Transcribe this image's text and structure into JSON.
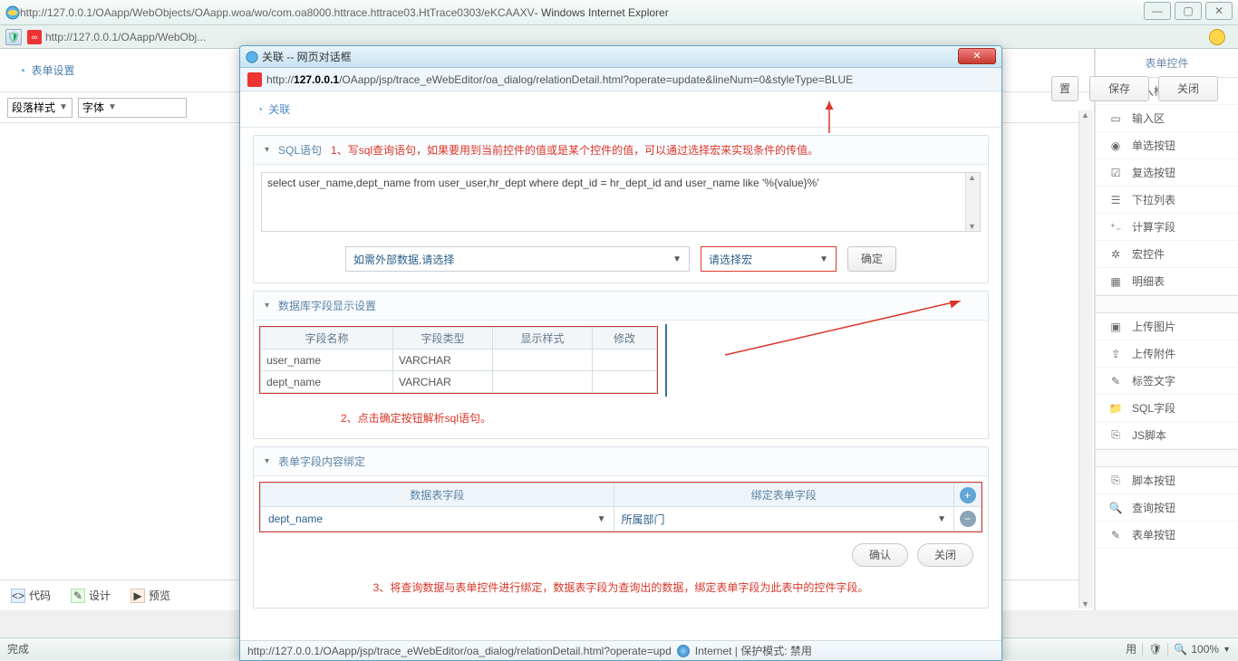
{
  "ie": {
    "url": "http://127.0.0.1/OAapp/WebObjects/OAapp.woa/wo/com.oa8000.httrace.httrace03.HtTrace0303/eKCAAXV",
    "title_suffix": " - Windows Internet Explorer",
    "tab_text": "http://127.0.0.1/OAapp/WebObj...",
    "status_done": "完成",
    "status_right_use": "用",
    "zoom": "100%"
  },
  "editor": {
    "header": "表单设置",
    "para_style": "段落样式",
    "font": "字体",
    "save": "保存",
    "close": "关闭",
    "bottom": {
      "code": "代码",
      "design": "设计",
      "preview": "预览"
    }
  },
  "rpanel": {
    "title": "表单控件",
    "items": [
      {
        "icon": "ABC",
        "label": "输入框"
      },
      {
        "icon": "▭",
        "label": "输入区"
      },
      {
        "icon": "◉",
        "label": "单选按钮"
      },
      {
        "icon": "☑",
        "label": "复选按钮"
      },
      {
        "icon": "☰",
        "label": "下拉列表"
      },
      {
        "icon": "⁺₋",
        "label": "计算字段"
      },
      {
        "icon": "✲",
        "label": "宏控件"
      },
      {
        "icon": "▦",
        "label": "明细表"
      }
    ],
    "items2": [
      {
        "icon": "▣",
        "label": "上传图片"
      },
      {
        "icon": "⇪",
        "label": "上传附件"
      },
      {
        "icon": "✎",
        "label": "标签文字"
      },
      {
        "icon": "📁",
        "label": "SQL字段"
      },
      {
        "icon": "⎘",
        "label": "JS脚本"
      }
    ],
    "items3": [
      {
        "icon": "⎘",
        "label": "脚本按钮"
      },
      {
        "icon": "🔍",
        "label": "查询按钮"
      },
      {
        "icon": "✎",
        "label": "表单按钮"
      }
    ]
  },
  "dialog": {
    "title": "关联 -- 网页对话框",
    "url_pre": "http://",
    "url_host": "127.0.0.1",
    "url_rest": "/OAapp/jsp/trace_eWebEditor/oa_dialog/relationDetail.html?operate=update&lineNum=0&styleType=BLUE",
    "head": "关联",
    "section1_label": "SQL语句",
    "ann1": "1、写sql查询语句，如果要用到当前控件的值或是某个控件的值，可以通过选择宏来实现条件的传值。",
    "sql": "select user_name,dept_name from user_user,hr_dept where dept_id = hr_dept_id and user_name like '%{value}%'",
    "ext_data": "如需外部数据,请选择",
    "macro_select": "请选择宏",
    "ok": "确定",
    "section2_label": "数据库字段显示设置",
    "fcols": [
      "字段名称",
      "字段类型",
      "显示样式",
      "修改"
    ],
    "frows": [
      {
        "name": "user_name",
        "type": "VARCHAR"
      },
      {
        "name": "dept_name",
        "type": "VARCHAR"
      }
    ],
    "ann2": "2、点击确定按钮解析sql语句。",
    "section3_label": "表单字段内容绑定",
    "bcols": [
      "数据表字段",
      "绑定表单字段"
    ],
    "brow": {
      "data": "dept_name",
      "form": "所属部门"
    },
    "confirm": "确认",
    "close": "关闭",
    "ann3": "3、将查询数据与表单控件进行绑定，数据表字段为查询出的数据，绑定表单字段为此表中的控件字段。",
    "status_url": "http://127.0.0.1/OAapp/jsp/trace_eWebEditor/oa_dialog/relationDetail.html?operate=upd",
    "status_zone": "Internet | 保护模式: 禁用"
  }
}
